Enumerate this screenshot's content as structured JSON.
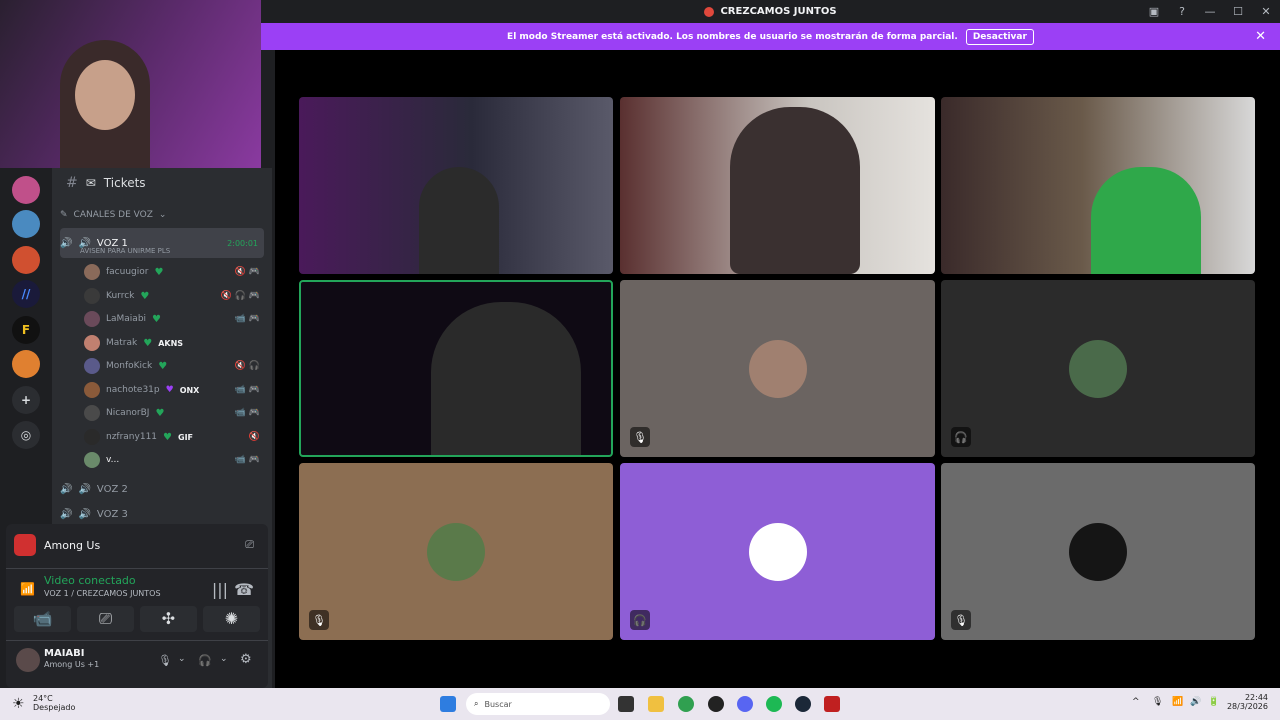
{
  "window": {
    "title": "CREZCAMOS JUNTOS",
    "minimize": "—",
    "maximize": "☐",
    "close": "✕"
  },
  "banner": {
    "text": "El modo Streamer está activado. Los nombres de usuario se mostrarán de forma parcial.",
    "button": "Desactivar",
    "close": "✕"
  },
  "channels": {
    "tickets": "Tickets",
    "category": "CANALES DE VOZ",
    "voz1": {
      "name": "VOZ 1",
      "timer": "2:00:01",
      "status": "AVISEN PARA UNIRME PLS"
    },
    "voz2": "VOZ 2",
    "voz3": "VOZ 3",
    "users": [
      {
        "name": "facuugior",
        "tag": ""
      },
      {
        "name": "Kurrck",
        "tag": ""
      },
      {
        "name": "LaMaiabi",
        "tag": ""
      },
      {
        "name": "Matrak",
        "tag": "AKNS"
      },
      {
        "name": "MonfoKick",
        "tag": ""
      },
      {
        "name": "nachote31p",
        "tag": "ONX"
      },
      {
        "name": "NicanorBJ",
        "tag": ""
      },
      {
        "name": "nzfrany111",
        "tag": "GIF"
      },
      {
        "name": "v...",
        "tag": ""
      }
    ]
  },
  "activity": {
    "game": "Among Us"
  },
  "voice_status": {
    "title": "Video conectado",
    "channel": "VOZ 1 / CREZCAMOS JUNTOS"
  },
  "user": {
    "name": "MAIABI",
    "status": "Among Us +1"
  },
  "taskbar": {
    "weather_temp": "24°C",
    "weather_desc": "Despejado",
    "search": "Buscar",
    "time": "22:44",
    "date": "28/3/2026"
  },
  "colors": {
    "accent": "#9b40f5",
    "speaking": "#23a55a",
    "tile_brown": "#8c6e52",
    "tile_purple": "#8e5ed6",
    "tile_gray": "#6b6b6b"
  }
}
